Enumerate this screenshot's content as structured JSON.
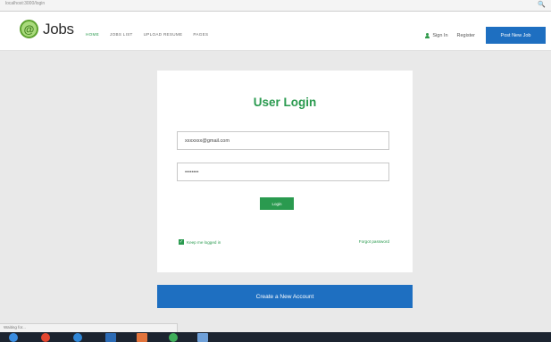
{
  "browser": {
    "url": "localhost:3000/login"
  },
  "header": {
    "logo_text": "Jobs",
    "nav_items": [
      {
        "label": "HOME"
      },
      {
        "label": "JOBS LIST"
      },
      {
        "label": "UPLOAD RESUME"
      },
      {
        "label": "PAGES"
      }
    ],
    "signin_label": "Sign In",
    "register_label": "Register",
    "post_job_label": "Post New Job"
  },
  "login": {
    "title": "User Login",
    "email_value": "xxxxxxx@gmail.com",
    "password_value": "••••••••",
    "login_button": "Login",
    "remember_label": "Keep me logged in",
    "forgot_label": "Forgot password"
  },
  "create_account_label": "Create a New Account",
  "statusbar": {
    "text": "Waiting for..."
  },
  "taskbar": {
    "apps": [
      {
        "name": "start-button",
        "color": "#3b8de0",
        "shape": "dot"
      },
      {
        "name": "chrome-app",
        "color": "#e2462f",
        "shape": "dot"
      },
      {
        "name": "ie-app",
        "color": "#2f86d6",
        "shape": "dot"
      },
      {
        "name": "explorer-app",
        "color": "#2c6bb5",
        "shape": "sq"
      },
      {
        "name": "office-app",
        "color": "#e2743c",
        "shape": "sq"
      },
      {
        "name": "green-app",
        "color": "#3fae5a",
        "shape": "dot"
      },
      {
        "name": "media-app",
        "color": "#6fa0d8",
        "shape": "sq"
      }
    ]
  },
  "colors": {
    "accent_green": "#2a9a4f",
    "accent_blue": "#1e6fc1",
    "page_background": "#e9e9e9"
  }
}
